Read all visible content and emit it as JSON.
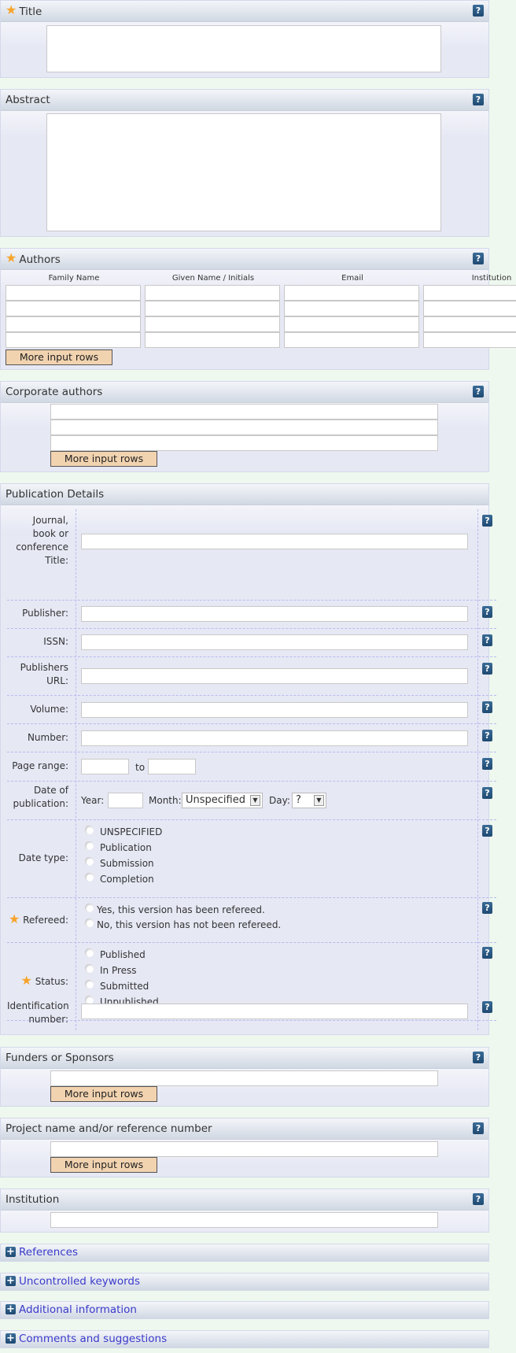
{
  "help_glyph": "?",
  "star_glyph": "★",
  "plus_glyph": "+",
  "title_section": {
    "label": "Title",
    "required": true
  },
  "abstract_section": {
    "label": "Abstract"
  },
  "authors_section": {
    "label": "Authors",
    "required": true,
    "columns": [
      "Family Name",
      "Given Name / Initials",
      "Email",
      "Institution"
    ],
    "row_count": 4,
    "more_rows_label": "More input rows"
  },
  "corporate_section": {
    "label": "Corporate authors",
    "row_count": 3,
    "more_rows_label": "More input rows"
  },
  "publication_details": {
    "label": "Publication Details",
    "fields": {
      "journal": "Journal, book or conference Title:",
      "publisher": "Publisher:",
      "issn": "ISSN:",
      "publishers_url": "Publishers URL:",
      "volume": "Volume:",
      "number": "Number:",
      "page_range": "Page range:",
      "page_range_to": "to",
      "date_of_publication": "Date of publication:",
      "year_label": "Year:",
      "month_label": "Month:",
      "month_value": "Unspecified",
      "day_label": "Day:",
      "day_value": "?",
      "date_type": "Date type:",
      "refereed": "Refereed:",
      "status": "Status:",
      "identification_number": "Identification number:"
    },
    "date_type_options": [
      "UNSPECIFIED",
      "Publication",
      "Submission",
      "Completion"
    ],
    "refereed_options": [
      "Yes, this version has been refereed.",
      "No, this version has not been refereed."
    ],
    "status_options": [
      "Published",
      "In Press",
      "Submitted",
      "Unpublished"
    ]
  },
  "funders_section": {
    "label": "Funders or Sponsors",
    "more_rows_label": "More input rows"
  },
  "project_section": {
    "label": "Project name and/or reference number",
    "more_rows_label": "More input rows"
  },
  "institution_section": {
    "label": "Institution"
  },
  "collapsed_sections": [
    "References",
    "Uncontrolled keywords",
    "Additional information",
    "Comments and suggestions"
  ],
  "colors": {
    "page_bg": "#eef8ee",
    "required_star": "#f7a42a",
    "help_icon": "#1f4a72",
    "more_button": "#f2d3b0",
    "collapsed_link": "#3a3acb"
  }
}
